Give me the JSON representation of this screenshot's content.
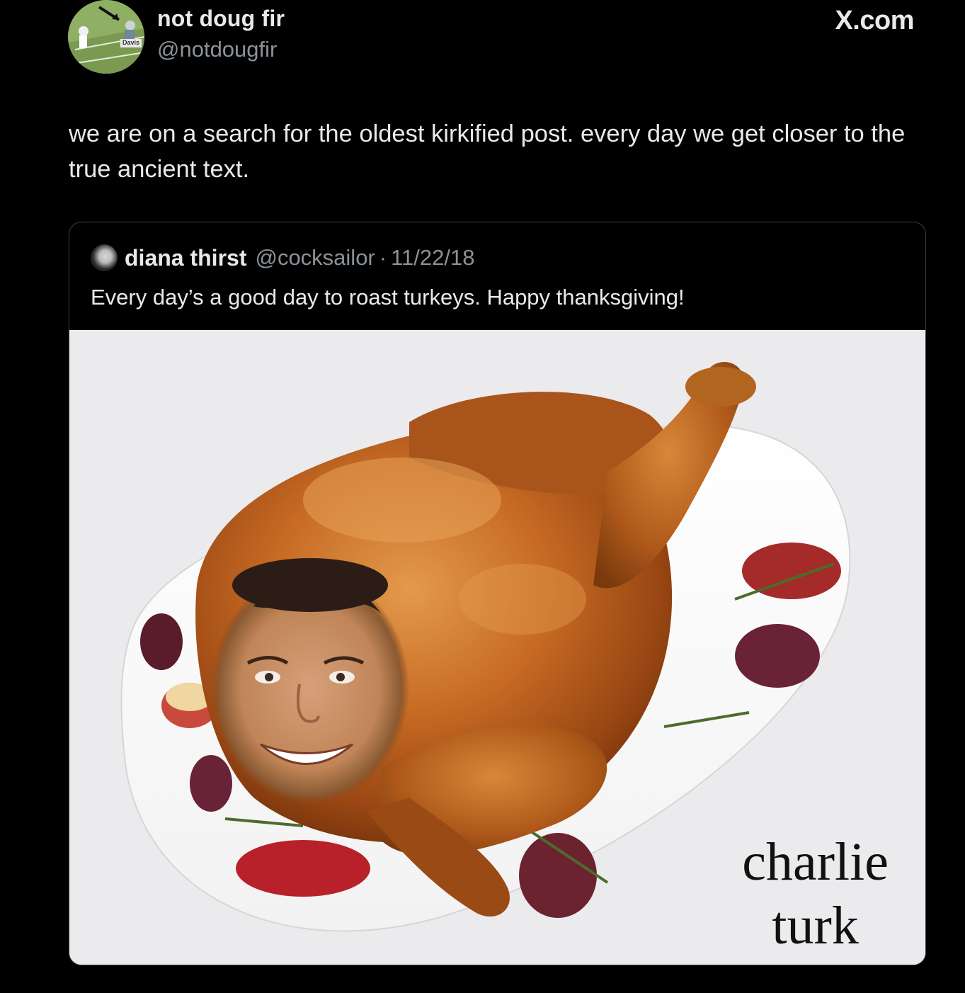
{
  "author": {
    "name": "not doug fir",
    "handle": "@notdougfir",
    "avatar_badge": "Davis"
  },
  "brand": "X.com",
  "tweet": {
    "text": "we are on a search for the oldest kirkified post. every day we get closer to the true ancient text."
  },
  "quoted": {
    "name": "diana thirst",
    "handle": "@cocksailor",
    "separator": "·",
    "date": "11/22/18",
    "text": "Every day’s a good day to roast turkeys. Happy thanksgiving!",
    "image_caption_line1": "charlie",
    "image_caption_line2": "turk"
  },
  "colors": {
    "background": "#000000",
    "text_primary": "#e7e9ea",
    "text_secondary": "#8b9298",
    "card_border": "#3a3f44",
    "media_background": "#ebebed"
  }
}
